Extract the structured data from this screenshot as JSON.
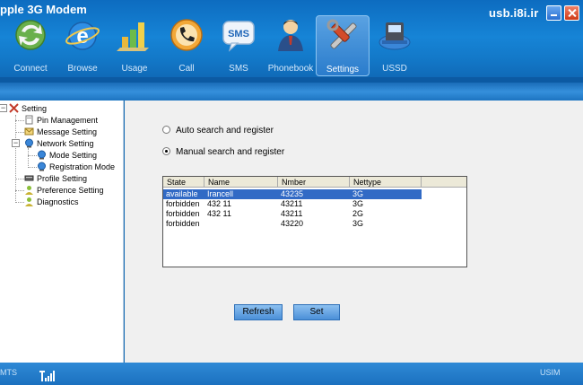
{
  "app": {
    "title": "pple 3G Modem",
    "site": "usb.i8i.ir"
  },
  "toolbar": [
    {
      "label": "Connect",
      "icon": "connect-icon"
    },
    {
      "label": "Browse",
      "icon": "browser-icon"
    },
    {
      "label": "Usage",
      "icon": "chart-icon"
    },
    {
      "label": "Call",
      "icon": "phone-icon"
    },
    {
      "label": "SMS",
      "icon": "sms-icon",
      "icon_text": "SMS"
    },
    {
      "label": "Phonebook",
      "icon": "contact-icon"
    },
    {
      "label": "Settings",
      "icon": "tools-icon",
      "active": true
    },
    {
      "label": "USSD",
      "icon": "ussd-icon"
    }
  ],
  "tree": {
    "root": "Setting",
    "items": [
      "Pin Management",
      "Message Setting",
      "Network Setting",
      "Mode Setting",
      "Registration Mode",
      "Profile Setting",
      "Preference Setting",
      "Diagnostics"
    ]
  },
  "network": {
    "auto_label": "Auto search and register",
    "manual_label": "Manual search and register",
    "selected_mode": "manual",
    "columns": [
      "State",
      "Name",
      "Nmber",
      "Nettype"
    ],
    "rows": [
      {
        "state": "available",
        "name": "Irancell",
        "number": "43235",
        "nettype": "3G",
        "selected": true
      },
      {
        "state": "forbidden",
        "name": "432 11",
        "number": "43211",
        "nettype": "3G"
      },
      {
        "state": "forbidden",
        "name": "432 11",
        "number": "43211",
        "nettype": "2G"
      },
      {
        "state": "forbidden",
        "name": "",
        "number": "43220",
        "nettype": "3G"
      }
    ],
    "refresh_label": "Refresh",
    "set_label": "Set"
  },
  "status": {
    "left": "MTS",
    "right": "USIM"
  },
  "colors": {
    "accent": "#1684d6",
    "selection": "#316ac5"
  }
}
